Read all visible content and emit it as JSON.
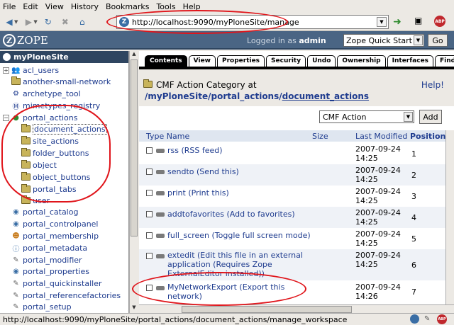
{
  "menu": [
    "File",
    "Edit",
    "View",
    "History",
    "Bookmarks",
    "Tools",
    "Help"
  ],
  "toolbar": {
    "url": "http://localhost:9090/myPloneSite/manage"
  },
  "zope": {
    "logo_text": "ZOPE",
    "logged_in_prefix": "Logged in as",
    "user": "admin",
    "quick_start": "Zope Quick Start",
    "go_label": "Go"
  },
  "tree": {
    "root": "myPloneSite",
    "items": [
      {
        "label": "acl_users"
      },
      {
        "label": "another-small-network"
      },
      {
        "label": "archetype_tool"
      },
      {
        "label": "mimetypes_registry"
      },
      {
        "label": "portal_actions"
      },
      {
        "label": "document_actions"
      },
      {
        "label": "site_actions"
      },
      {
        "label": "folder_buttons"
      },
      {
        "label": "object"
      },
      {
        "label": "object_buttons"
      },
      {
        "label": "portal_tabs"
      },
      {
        "label": "user"
      },
      {
        "label": "portal_catalog"
      },
      {
        "label": "portal_controlpanel"
      },
      {
        "label": "portal_membership"
      },
      {
        "label": "portal_metadata"
      },
      {
        "label": "portal_modifier"
      },
      {
        "label": "portal_properties"
      },
      {
        "label": "portal_quickinstaller"
      },
      {
        "label": "portal_referencefactories"
      },
      {
        "label": "portal_setup"
      }
    ]
  },
  "tabs": [
    "Contents",
    "View",
    "Properties",
    "Security",
    "Undo",
    "Ownership",
    "Interfaces",
    "Find",
    "F"
  ],
  "main": {
    "category_title": "CMF Action Category at",
    "path_prefix": "/myPloneSite/portal_actions/",
    "path_link": "document_actions",
    "help": "Help!",
    "add_select": "CMF Action",
    "add_button": "Add",
    "columns": {
      "type_name": "Type Name",
      "size": "Size",
      "modified": "Last Modified",
      "position": "Position"
    },
    "rows": [
      {
        "name": "rss (RSS feed)",
        "date": "2007-09-24",
        "time": "14:25",
        "position": "1"
      },
      {
        "name": "sendto (Send this)",
        "date": "2007-09-24",
        "time": "14:25",
        "position": "2"
      },
      {
        "name": "print (Print this)",
        "date": "2007-09-24",
        "time": "14:25",
        "position": "3"
      },
      {
        "name": "addtofavorites (Add to favorites)",
        "date": "2007-09-24",
        "time": "14:25",
        "position": "4"
      },
      {
        "name": "full_screen (Toggle full screen mode)",
        "date": "2007-09-24",
        "time": "14:25",
        "position": "5"
      },
      {
        "name": "extedit (Edit this file in an external application (Requires Zope ExternalEditor installed))",
        "date": "2007-09-24",
        "time": "14:25",
        "position": "6"
      },
      {
        "name": "MyNetworkExport (Export this network)",
        "date": "2007-09-24",
        "time": "14:26",
        "position": "7"
      }
    ]
  },
  "status": "http://localhost:9090/myPloneSite/portal_actions/document_actions/manage_workspace",
  "colors": {
    "accent_red": "#e0151b",
    "zope_blue": "#4a6584",
    "link": "#1f3c8f"
  }
}
